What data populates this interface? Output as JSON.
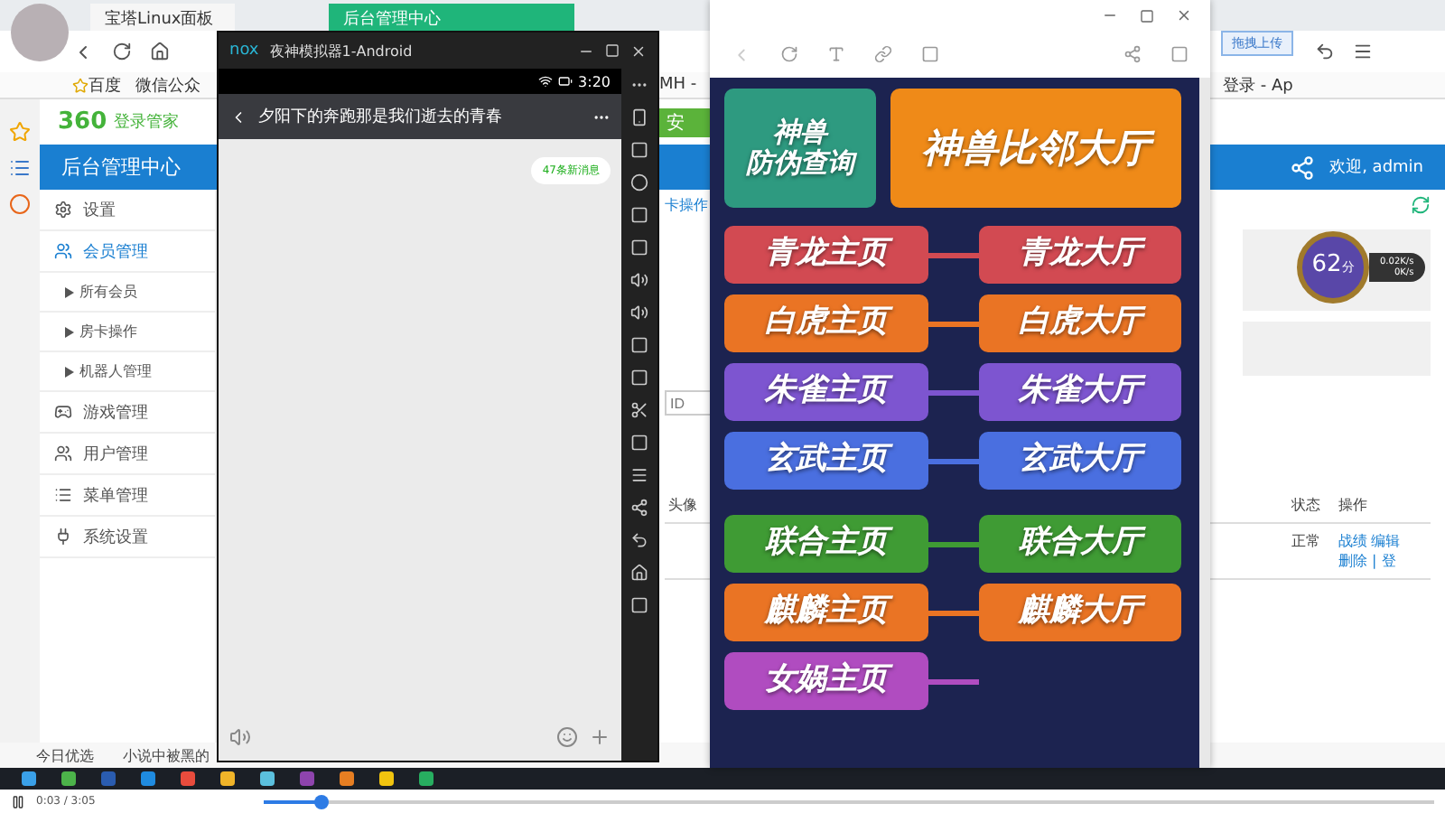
{
  "browser": {
    "tabs": [
      {
        "label": "宝塔Linux面板",
        "selected": false
      },
      {
        "label": "后台管理中心",
        "selected": true
      }
    ],
    "bookmarks": [
      "百度",
      "微信公众"
    ],
    "bookmarks_right": [
      "MH -",
      "登录 - Ap"
    ],
    "upload_button": "拖拽上传"
  },
  "admin": {
    "logo_mark": "360",
    "logo_text": "登录管家",
    "title": "后台管理中心",
    "user": "欢迎, admin",
    "green_button": "安",
    "breadcrumb": "卡操作",
    "search": {
      "placeholder": "ID"
    },
    "sidebar": [
      {
        "label": "设置",
        "expanded": false
      },
      {
        "label": "会员管理",
        "expanded": true,
        "children": [
          {
            "label": "所有会员"
          },
          {
            "label": "房卡操作"
          },
          {
            "label": "机器人管理"
          }
        ]
      },
      {
        "label": "游戏管理",
        "expanded": false
      },
      {
        "label": "用户管理",
        "expanded": false
      },
      {
        "label": "菜单管理",
        "expanded": false
      },
      {
        "label": "系统设置",
        "expanded": false
      }
    ],
    "table": {
      "columns": [
        "头像",
        "状态",
        "操作"
      ],
      "rows": [
        {
          "status": "正常",
          "actions": [
            "战绩",
            "编辑",
            "删除 | 登"
          ]
        }
      ]
    }
  },
  "emulator": {
    "logo": "nox",
    "title": "夜神模拟器1-Android",
    "time": "3:20",
    "chat_title": "夕阳下的奔跑那是我们逝去的青春",
    "new_messages": "47条新消息"
  },
  "game_menu": {
    "top": [
      {
        "lines": [
          "神兽",
          "防伪查询"
        ],
        "color": "#2e9a80"
      },
      {
        "lines": [
          "神兽比邻大厅"
        ],
        "color": "#ef8a18"
      }
    ],
    "pairs": [
      {
        "home": "青龙主页",
        "hall": "青龙大厅",
        "color": "#d24a52"
      },
      {
        "home": "白虎主页",
        "hall": "白虎大厅",
        "color": "#ea7424"
      },
      {
        "home": "朱雀主页",
        "hall": "朱雀大厅",
        "color": "#7d55d0"
      },
      {
        "home": "玄武主页",
        "hall": "玄武大厅",
        "color": "#4a6fe0"
      },
      {
        "home": "联合主页",
        "hall": "联合大厅",
        "color": "#3f9b34"
      },
      {
        "home": "麒麟主页",
        "hall": "麒麟大厅",
        "color": "#ea7424"
      },
      {
        "home": "女娲主页",
        "color": "#b04cc0"
      }
    ]
  },
  "speed": {
    "score": "62",
    "unit": "分",
    "up": "0.02K/s",
    "down": "0K/s"
  },
  "bottom_bar": {
    "items": [
      "今日优选",
      "小说中被黑的"
    ]
  },
  "player": {
    "time": "0:03 / 3:05",
    "level": 0.05
  }
}
